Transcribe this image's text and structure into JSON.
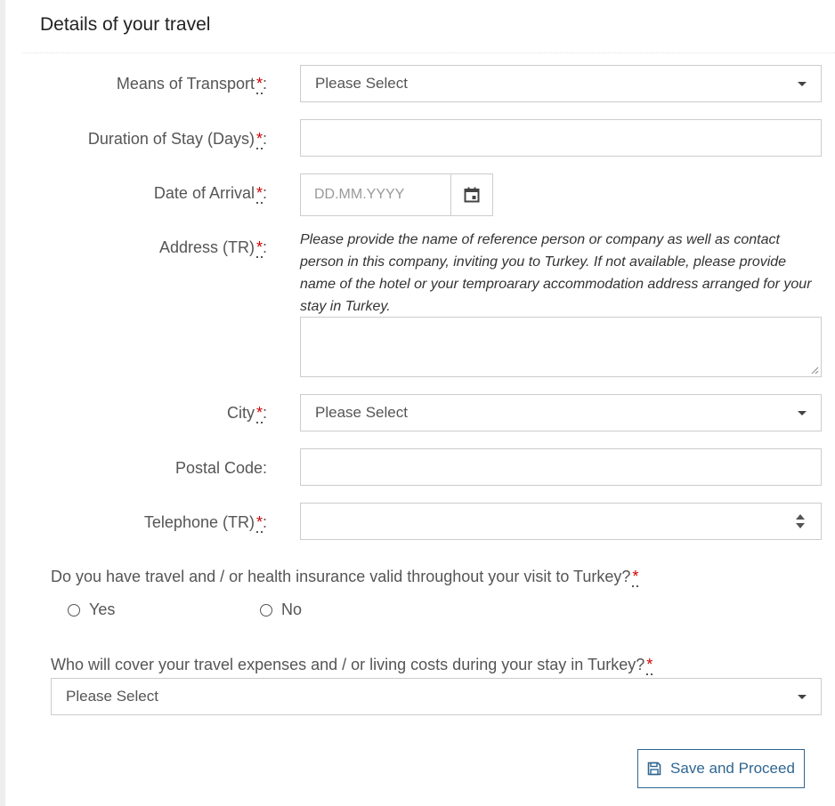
{
  "section": {
    "title": "Details of your travel"
  },
  "required_marker": "*",
  "colon": ":",
  "fields": {
    "transport": {
      "label": "Means of Transport",
      "value": "Please Select"
    },
    "duration": {
      "label": "Duration of Stay (Days)",
      "value": ""
    },
    "arrival": {
      "label": "Date of Arrival",
      "placeholder": "DD.MM.YYYY"
    },
    "address": {
      "label": "Address (TR)",
      "hint": "Please provide the name of reference person or company as well as contact person in this company, inviting you to Turkey. If not available, please provide name of the hotel or your temproarary accommodation address arranged for your stay in Turkey.",
      "value": ""
    },
    "city": {
      "label": "City",
      "value": "Please Select"
    },
    "postal": {
      "label": "Postal Code:",
      "value": ""
    },
    "telephone": {
      "label": "Telephone (TR)",
      "value": ""
    }
  },
  "insurance": {
    "question": "Do you have travel and / or health insurance valid throughout your visit to Turkey?",
    "options": [
      "Yes",
      "No"
    ]
  },
  "expenses": {
    "question": "Who will cover your travel expenses and / or living costs during your stay in Turkey?",
    "value": "Please Select"
  },
  "actions": {
    "save_label": "Save and Proceed"
  },
  "colors": {
    "accent": "#2f6690",
    "required": "#d00000",
    "border": "#cccccc"
  },
  "icons": {
    "calendar": "calendar-icon",
    "save": "floppy-disk-icon"
  }
}
